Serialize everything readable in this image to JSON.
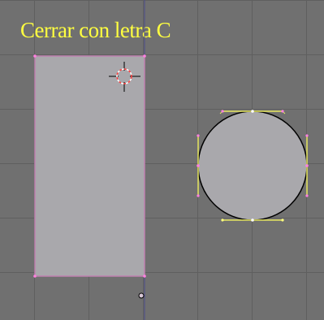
{
  "viewport": {
    "caption": "Cerrar con letra C",
    "colors": {
      "background": "#707070",
      "grid_line": "#5f5f5f",
      "shape_fill": "#a9a8ac",
      "rectangle_edge": "#c080b0",
      "curve_outline": "#000000",
      "handle_line": "#e8e860",
      "control_point": "#ff80e0",
      "caption_text": "#ffff40",
      "cursor_ring": "#ff4040"
    },
    "objects": [
      "rectangle-curve",
      "circle-curve",
      "3d-cursor",
      "object-origin"
    ]
  }
}
